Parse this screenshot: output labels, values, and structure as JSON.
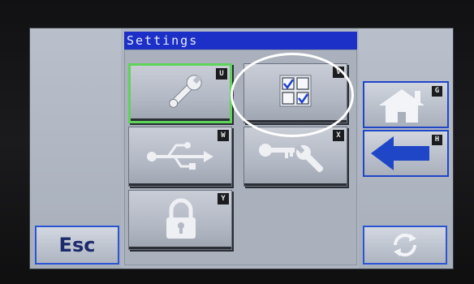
{
  "title": "Settings",
  "tiles": [
    {
      "icon": "wrench-icon",
      "key": "U",
      "selected": true
    },
    {
      "icon": "checkbox-grid-icon",
      "key": "V",
      "selected": false
    },
    {
      "icon": "usb-icon",
      "key": "W",
      "selected": false
    },
    {
      "icon": "key-wrench-icon",
      "key": "X",
      "selected": false
    },
    {
      "icon": "lock-icon",
      "key": "Y",
      "selected": false
    }
  ],
  "side_buttons": {
    "home": {
      "icon": "home-icon",
      "key": "G"
    },
    "back": {
      "icon": "back-arrow-icon",
      "key": "H"
    },
    "refresh": {
      "icon": "refresh-icon"
    }
  },
  "esc_label": "Esc",
  "colors": {
    "title_bar": "#1c2fc6",
    "selected_border": "#5fd35a",
    "accent_blue": "#1f46c6"
  }
}
